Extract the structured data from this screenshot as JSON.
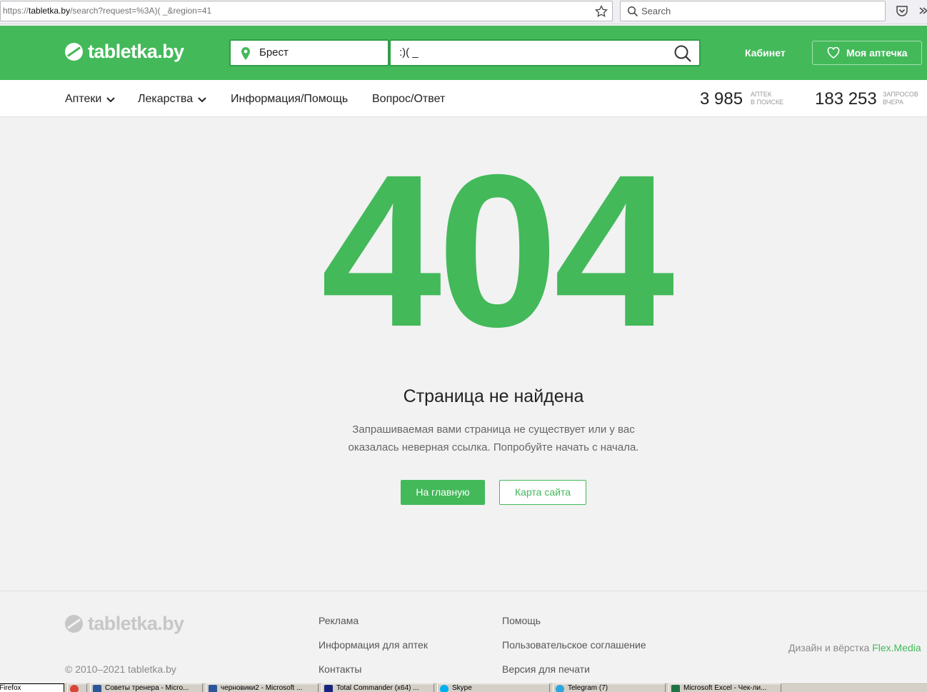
{
  "browser": {
    "url_prefix": "https://",
    "url_host": "tabletka.by",
    "url_path": "/search?request=%3A)( _&region=41",
    "search_placeholder": "Search"
  },
  "header": {
    "logo_text": "tabletka.by",
    "region": "Брест",
    "query": ":)( _",
    "cabinet_label": "Кабинет",
    "my_pharmacy_label": "Моя аптечка"
  },
  "nav": {
    "items": [
      {
        "label": "Аптеки",
        "has_dropdown": true
      },
      {
        "label": "Лекарства",
        "has_dropdown": true
      },
      {
        "label": "Информация/Помощь",
        "has_dropdown": false
      },
      {
        "label": "Вопрос/Ответ",
        "has_dropdown": false
      }
    ],
    "stats": [
      {
        "value": "3 985",
        "label_line1": "АПТЕК",
        "label_line2": "В ПОИСКЕ"
      },
      {
        "value": "183 253",
        "label_line1": "ЗАПРОСОВ",
        "label_line2": "ВЧЕРА"
      }
    ]
  },
  "error": {
    "code": "404",
    "title": "Страница не найдена",
    "message": "Запрашиваемая вами страница не существует или у вас оказалась неверная ссылка. Попробуйте начать с начала.",
    "home_button": "На главную",
    "sitemap_button": "Карта сайта"
  },
  "footer": {
    "logo_text": "tabletka.by",
    "copyright": "© 2010–2021 tabletka.by",
    "col1": [
      "Реклама",
      "Информация для аптек",
      "Контакты"
    ],
    "col2": [
      "Помощь",
      "Пользовательское соглашение",
      "Версия для печати"
    ],
    "credits_prefix": "Дизайн и вёрстка ",
    "credits_brand": "Flex.Media"
  },
  "taskbar": {
    "items": [
      {
        "label": "Firefox",
        "icon": "firefox-icon"
      },
      {
        "label": "",
        "icon": "chrome-icon"
      },
      {
        "label": "Советы тренера - Micro...",
        "icon": "word-icon"
      },
      {
        "label": "черновики2 - Microsoft ...",
        "icon": "word-icon"
      },
      {
        "label": "Total Commander (x64) ...",
        "icon": "save-icon"
      },
      {
        "label": "Skype",
        "icon": "skype-icon"
      },
      {
        "label": "Telegram (7)",
        "icon": "telegram-icon"
      },
      {
        "label": "Microsoft Excel - Чек-ли...",
        "icon": "excel-icon"
      }
    ]
  },
  "colors": {
    "brand_green": "#43b95a",
    "brand_green_dark": "#2e9e47",
    "page_bg": "#f2f2f2"
  }
}
